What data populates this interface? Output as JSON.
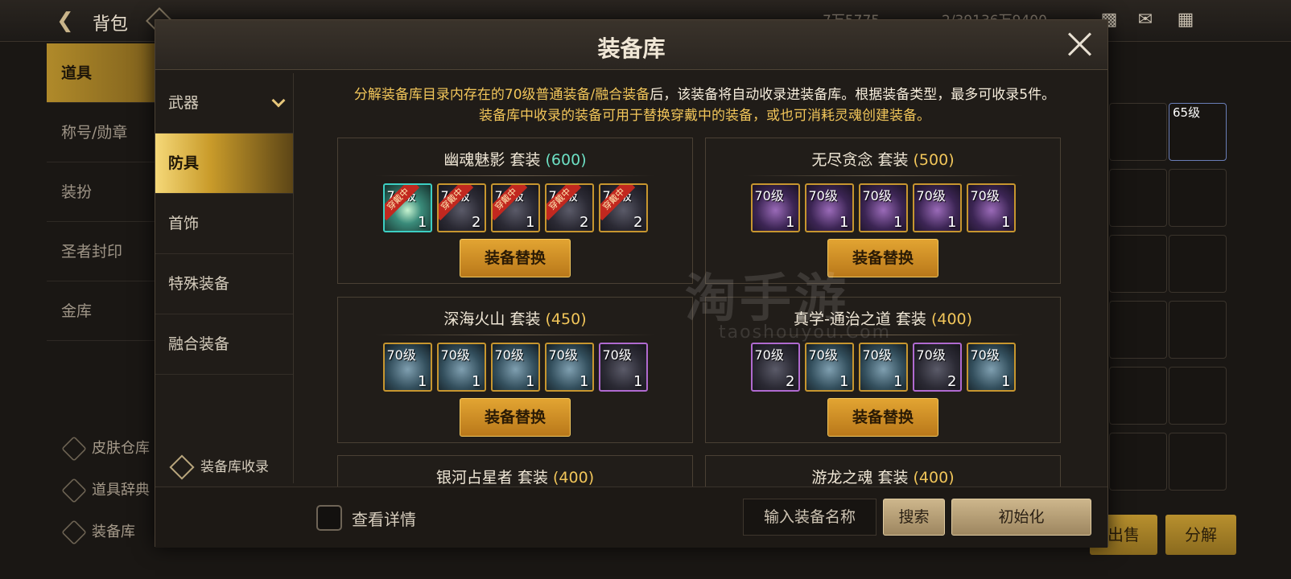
{
  "background": {
    "bag_title": "背包",
    "top_values": [
      "7万5775",
      "2/39136万9400"
    ],
    "left_menu": [
      {
        "label": "道具",
        "active": true
      },
      {
        "label": "称号/勋章",
        "active": false
      },
      {
        "label": "装扮",
        "active": false
      },
      {
        "label": "圣者封印",
        "active": false
      },
      {
        "label": "金库",
        "active": false
      }
    ],
    "bottom_links": [
      "皮肤仓库",
      "道具辞典",
      "装备库"
    ],
    "right_slot_level": "65级",
    "sell_label": "出售",
    "decompose_label": "分解"
  },
  "modal": {
    "title": "装备库",
    "categories": [
      {
        "label": "武器",
        "active": false,
        "has_chevron": true
      },
      {
        "label": "防具",
        "active": true
      },
      {
        "label": "首饰",
        "active": false
      },
      {
        "label": "特殊装备",
        "active": false
      },
      {
        "label": "融合装备",
        "active": false
      }
    ],
    "intro_line1_highlight": "分解装备库目录内存在的70级普通装备/融合装备",
    "intro_line1_rest": "后，该装备将自动收录进装备库。根据装备类型，最多可收录5件。",
    "intro_line2": "装备库中收录的装备可用于替换穿戴中的装备，或也可消耗灵魂创建装备。",
    "wearing_ribbon": "穿戴中",
    "sets": [
      {
        "name": "幽魂魅影",
        "suffix": "套装",
        "score": "(600)",
        "score_color": "cyan",
        "items": [
          {
            "level": "70级",
            "count": "1",
            "wearing": true,
            "style": "cyan"
          },
          {
            "level": "70级",
            "count": "2",
            "wearing": true,
            "style": ""
          },
          {
            "level": "70级",
            "count": "1",
            "wearing": true,
            "style": ""
          },
          {
            "level": "70级",
            "count": "2",
            "wearing": true,
            "style": ""
          },
          {
            "level": "70级",
            "count": "2",
            "wearing": true,
            "style": ""
          }
        ],
        "button": "装备替换"
      },
      {
        "name": "无尽贪念",
        "suffix": "套装",
        "score": "(500)",
        "score_color": "gold",
        "items": [
          {
            "level": "70级",
            "count": "1",
            "wearing": false,
            "style": "violet"
          },
          {
            "level": "70级",
            "count": "1",
            "wearing": false,
            "style": "violet"
          },
          {
            "level": "70级",
            "count": "1",
            "wearing": false,
            "style": "violet"
          },
          {
            "level": "70级",
            "count": "1",
            "wearing": false,
            "style": "violet"
          },
          {
            "level": "70级",
            "count": "1",
            "wearing": false,
            "style": "violet"
          }
        ],
        "button": "装备替换"
      },
      {
        "name": "深海火山",
        "suffix": "套装",
        "score": "(450)",
        "score_color": "gold",
        "items": [
          {
            "level": "70级",
            "count": "1",
            "wearing": false,
            "style": "steel"
          },
          {
            "level": "70级",
            "count": "1",
            "wearing": false,
            "style": "steel"
          },
          {
            "level": "70级",
            "count": "1",
            "wearing": false,
            "style": "steel"
          },
          {
            "level": "70级",
            "count": "1",
            "wearing": false,
            "style": "steel"
          },
          {
            "level": "70级",
            "count": "1",
            "wearing": false,
            "style": "purple"
          }
        ],
        "button": "装备替换"
      },
      {
        "name": "真学-通治之道",
        "suffix": "套装",
        "score": "(400)",
        "score_color": "gold",
        "items": [
          {
            "level": "70级",
            "count": "2",
            "wearing": false,
            "style": "purple"
          },
          {
            "level": "70级",
            "count": "1",
            "wearing": false,
            "style": "steel"
          },
          {
            "level": "70级",
            "count": "1",
            "wearing": false,
            "style": "steel"
          },
          {
            "level": "70级",
            "count": "2",
            "wearing": false,
            "style": "purple"
          },
          {
            "level": "70级",
            "count": "1",
            "wearing": false,
            "style": "steel"
          }
        ],
        "button": "装备替换"
      },
      {
        "name": "银河占星者",
        "suffix": "套装",
        "score": "(400)",
        "score_color": "gold"
      },
      {
        "name": "游龙之魂",
        "suffix": "套装",
        "score": "(400)",
        "score_color": "gold"
      }
    ],
    "collect_link": "装备库收录",
    "detail_checkbox_label": "查看详情",
    "search_placeholder": "输入装备名称",
    "search_button": "搜索",
    "reset_button": "初始化"
  },
  "watermark": {
    "main": "淘手游",
    "sub": "taoshouyou.Com"
  }
}
